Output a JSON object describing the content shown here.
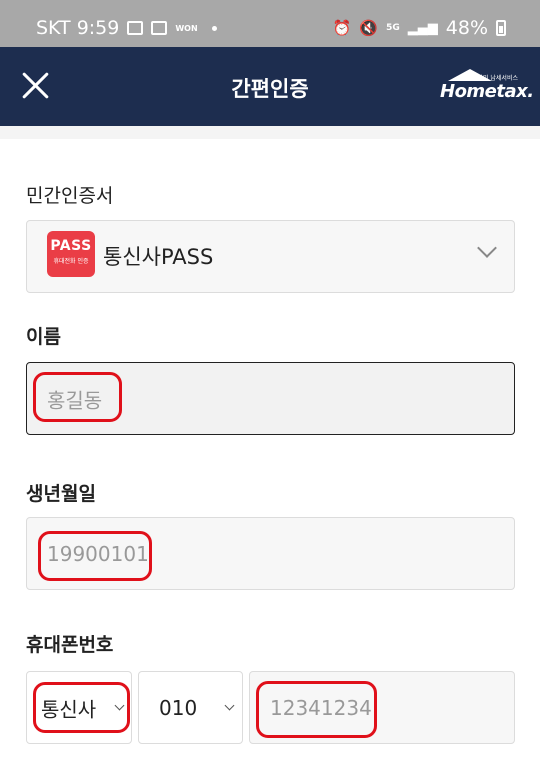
{
  "status_bar": {
    "carrier_time": "SKT 9:59",
    "won": "WON",
    "network": "5G",
    "battery": "48%"
  },
  "header": {
    "title": "간편인증",
    "logo_text": "Hometax.",
    "logo_sub": "전자민 납세서비스"
  },
  "cert": {
    "label": "민간인증서",
    "icon_text": "PASS",
    "icon_sub": "휴대전화 인증",
    "selected": "통신사PASS"
  },
  "name": {
    "label": "이름",
    "placeholder": "홍길동"
  },
  "birth": {
    "label": "생년월일",
    "placeholder": "19900101"
  },
  "phone": {
    "label": "휴대폰번호",
    "carrier": "통신사",
    "prefix": "010",
    "placeholder": "12341234"
  }
}
